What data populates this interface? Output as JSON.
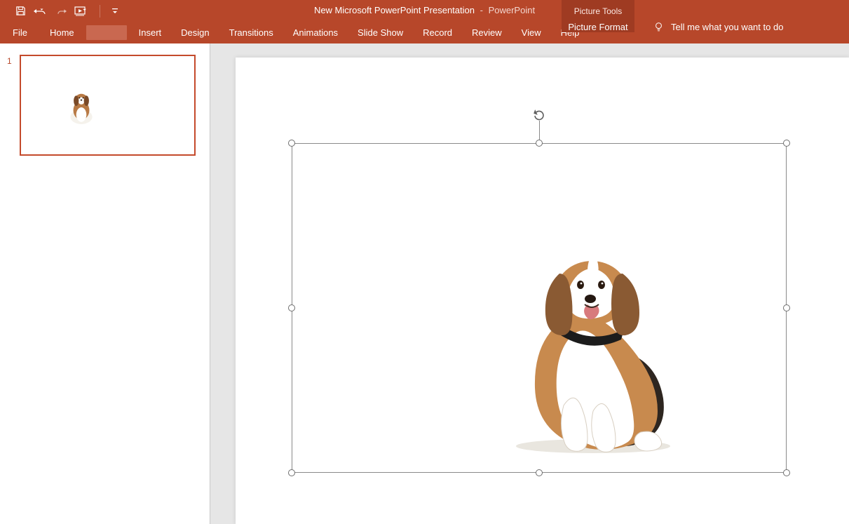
{
  "title": {
    "filename": "New Microsoft PowerPoint Presentation",
    "separator": "-",
    "app": "PowerPoint",
    "context_tab": "Picture Tools"
  },
  "qat_icons": {
    "save": "save-icon",
    "undo": "undo-icon",
    "redo": "redo-icon",
    "start": "start-from-beginning-icon",
    "customize": "customize-qat-icon"
  },
  "tabs": {
    "file": "File",
    "home": "Home",
    "blank": "      ",
    "insert": "Insert",
    "design": "Design",
    "transitions": "Transitions",
    "animations": "Animations",
    "slideshow": "Slide Show",
    "record": "Record",
    "review": "Review",
    "view": "View",
    "help": "Help",
    "picture_format": "Picture Format"
  },
  "tell_me": "Tell me what you want to do",
  "thumbnail": {
    "slide_number": "1"
  },
  "selection": {
    "object_name": "dog-picture"
  }
}
